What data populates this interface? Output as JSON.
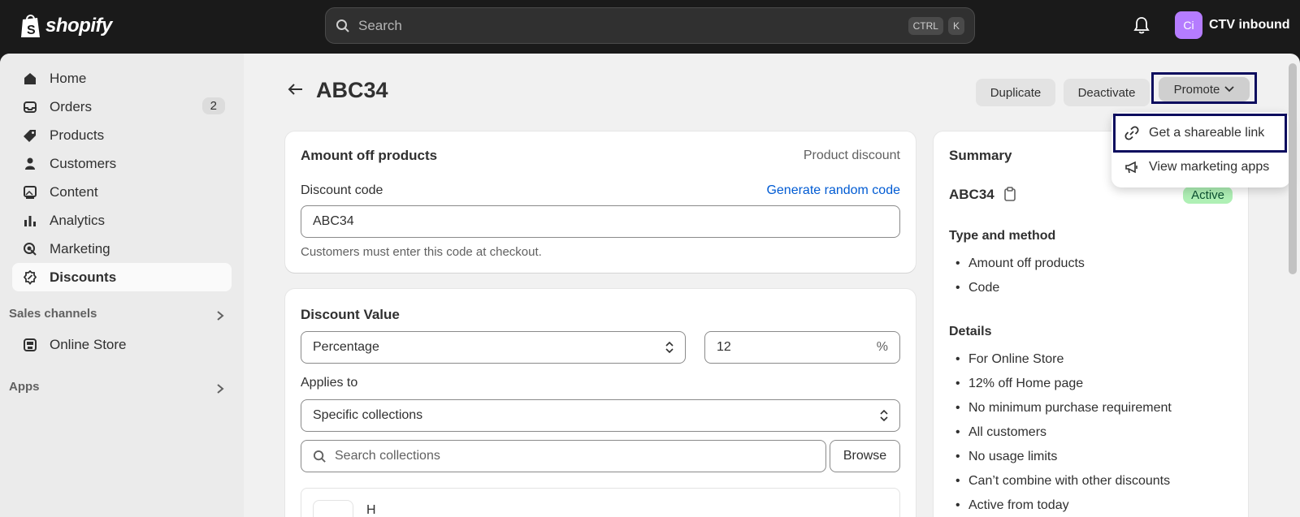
{
  "topbar": {
    "logo_text": "shopify",
    "search_placeholder": "Search",
    "shortcut_ctrl": "CTRL",
    "shortcut_k": "K",
    "avatar_initials": "Ci",
    "store_name": "CTV inbound"
  },
  "sidebar": {
    "items": [
      {
        "label": "Home",
        "icon": "home-icon"
      },
      {
        "label": "Orders",
        "icon": "inbox-icon",
        "badge": "2"
      },
      {
        "label": "Products",
        "icon": "tag-icon"
      },
      {
        "label": "Customers",
        "icon": "person-icon"
      },
      {
        "label": "Content",
        "icon": "image-icon"
      },
      {
        "label": "Analytics",
        "icon": "bar-chart-icon"
      },
      {
        "label": "Marketing",
        "icon": "target-icon"
      },
      {
        "label": "Discounts",
        "icon": "discount-icon",
        "active": true
      }
    ],
    "sales_channels_label": "Sales channels",
    "online_store_label": "Online Store",
    "apps_label": "Apps"
  },
  "page": {
    "title": "ABC34",
    "duplicate_label": "Duplicate",
    "deactivate_label": "Deactivate",
    "promote_label": "Promote"
  },
  "promote_menu": {
    "items": [
      "Get a shareable link",
      "View marketing apps"
    ]
  },
  "amount_card": {
    "title": "Amount off products",
    "type_label": "Product discount",
    "code_label": "Discount code",
    "generate_label": "Generate random code",
    "code_value": "ABC34",
    "help_text": "Customers must enter this code at checkout."
  },
  "value_card": {
    "title": "Discount Value",
    "type_value": "Percentage",
    "amount_value": "12",
    "amount_suffix": "%",
    "applies_label": "Applies to",
    "applies_value": "Specific collections",
    "search_placeholder": "Search collections",
    "browse_label": "Browse",
    "partial_item": "H"
  },
  "summary": {
    "title": "Summary",
    "code": "ABC34",
    "status": "Active",
    "type_heading": "Type and method",
    "type_items": [
      "Amount off products",
      "Code"
    ],
    "details_heading": "Details",
    "details_items": [
      "For Online Store",
      "12% off Home page",
      "No minimum purchase requirement",
      "All customers",
      "No usage limits",
      "Can’t combine with other discounts",
      "Active from today"
    ]
  }
}
